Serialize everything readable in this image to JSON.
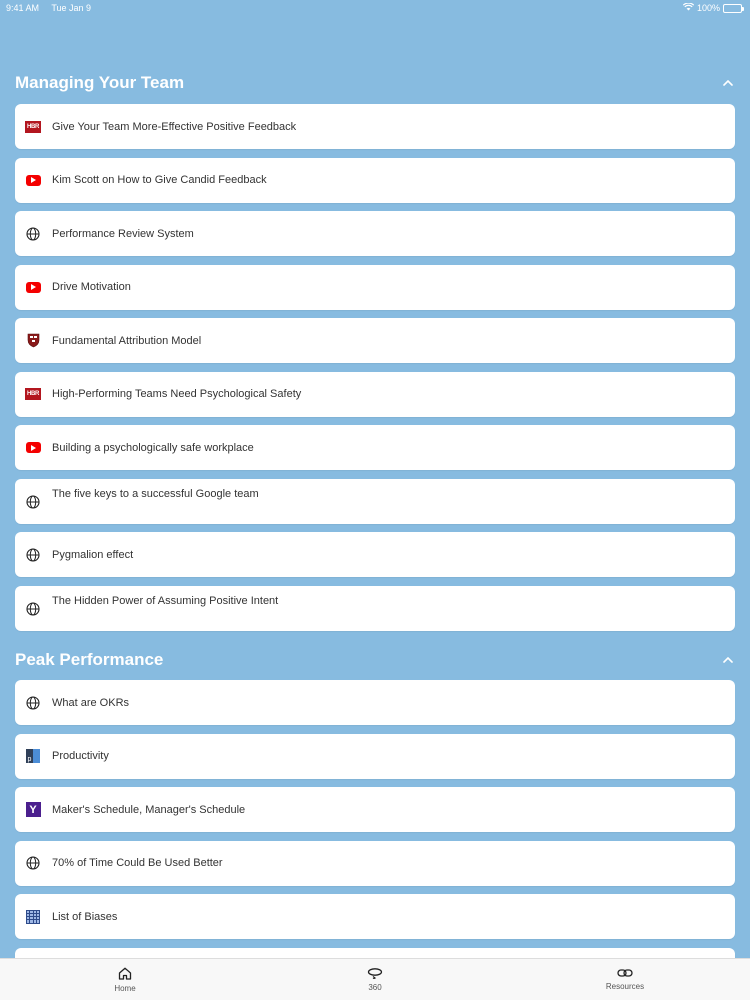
{
  "status_bar": {
    "time": "9:41 AM",
    "date": "Tue Jan 9",
    "battery": "100%"
  },
  "sections": [
    {
      "title": "Managing Your Team",
      "items": [
        {
          "label": "Give Your Team More-Effective Positive Feedback",
          "icon": "hbr-icon"
        },
        {
          "label": "Kim Scott on How to Give Candid Feedback",
          "icon": "youtube-icon"
        },
        {
          "label": "Performance Review System",
          "icon": "globe-icon"
        },
        {
          "label": "Drive Motivation",
          "icon": "youtube-icon"
        },
        {
          "label": "Fundamental Attribution Model",
          "icon": "harvard-shield-icon"
        },
        {
          "label": "High-Performing Teams Need Psychological Safety",
          "icon": "hbr-icon"
        },
        {
          "label": "Building a psychologically safe workplace",
          "icon": "youtube-icon"
        },
        {
          "label": "The five keys to a successful Google team",
          "icon": "globe-icon"
        },
        {
          "label": "Pygmalion effect",
          "icon": "globe-icon"
        },
        {
          "label": "The Hidden Power of Assuming Positive Intent",
          "icon": "globe-icon"
        }
      ]
    },
    {
      "title": "Peak Performance",
      "items": [
        {
          "label": "What are OKRs",
          "icon": "globe-icon"
        },
        {
          "label": "Productivity",
          "icon": "productivity-icon"
        },
        {
          "label": "Maker's Schedule, Manager's Schedule",
          "icon": "y-combinator-icon"
        },
        {
          "label": "70% of Time Could Be Used Better",
          "icon": "globe-icon"
        },
        {
          "label": "List of Biases",
          "icon": "bias-grid-icon"
        }
      ]
    }
  ],
  "tab_bar": {
    "tabs": [
      {
        "label": "Home",
        "icon": "house-icon"
      },
      {
        "label": "360",
        "icon": "rotate-360-icon"
      },
      {
        "label": "Resources",
        "icon": "link-icon"
      }
    ]
  },
  "colors": {
    "background": "#87bbe0",
    "card": "#ffffff",
    "hbr": "#b3161f",
    "youtube": "#f40000"
  }
}
